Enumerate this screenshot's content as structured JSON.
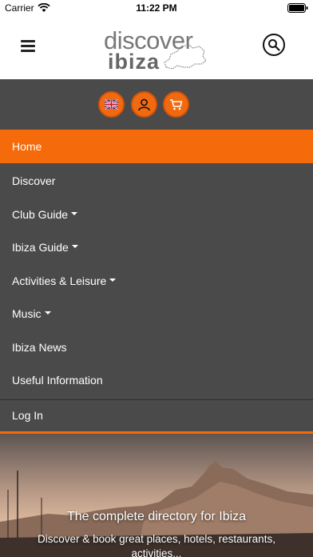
{
  "status_bar": {
    "carrier": "Carrier",
    "time": "11:22 PM"
  },
  "header": {
    "logo_top": "discover",
    "logo_bottom": "ibiza"
  },
  "quick_icons": [
    {
      "name": "language-flag-uk-icon"
    },
    {
      "name": "user-account-icon"
    },
    {
      "name": "shopping-cart-icon"
    }
  ],
  "menu": {
    "items": [
      {
        "label": "Home",
        "active": true
      },
      {
        "label": "Discover"
      },
      {
        "label": "Club Guide",
        "dropdown": true
      },
      {
        "label": "Ibiza Guide",
        "dropdown": true
      },
      {
        "label": "Activities & Leisure",
        "dropdown": true
      },
      {
        "label": "Music",
        "dropdown": true
      },
      {
        "label": "Ibiza News"
      },
      {
        "label": "Useful Information"
      },
      {
        "label": "Log In"
      }
    ]
  },
  "hero": {
    "title": "The complete directory for Ibiza",
    "subtitle": "Discover & book great places, hotels, restaurants, activities..."
  },
  "colors": {
    "accent": "#f56a0a",
    "menu_bg": "#4a4a4a"
  }
}
